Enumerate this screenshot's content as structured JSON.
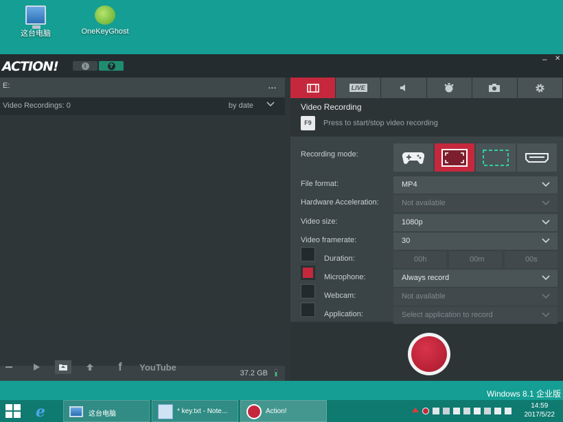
{
  "desktop": {
    "icons": [
      {
        "label": "这台电脑",
        "icon": "computer-icon"
      },
      {
        "label": "OneKeyGhost",
        "icon": "onekeyghost-icon"
      }
    ],
    "edition": "Windows 8.1 企业版"
  },
  "app": {
    "logo": "ACTION!",
    "info_glyph": "i",
    "help_glyph": "?",
    "min": "–",
    "close": "✕",
    "path": "E:",
    "path_menu": "...",
    "recordings_label": "Video Recordings: 0",
    "sort": "by date",
    "disk_free": "37.2 GB",
    "live_label": "LIVE",
    "hotkey": "F9",
    "section_title": "Video Recording",
    "hotkey_hint": "Press to start/stop video recording",
    "settings": {
      "recording_mode": "Recording mode:",
      "file_format": {
        "label": "File format:",
        "value": "MP4"
      },
      "hw_accel": {
        "label": "Hardware Acceleration:",
        "value": "Not available"
      },
      "video_size": {
        "label": "Video size:",
        "value": "1080p"
      },
      "framerate": {
        "label": "Video framerate:",
        "value": "30"
      },
      "duration": {
        "label": "Duration:",
        "h": "00h",
        "m": "00m",
        "s": "00s"
      },
      "microphone": {
        "label": "Microphone:",
        "value": "Always record"
      },
      "webcam": {
        "label": "Webcam:",
        "value": "Not available"
      },
      "application": {
        "label": "Application:",
        "value": "Select application to record"
      }
    },
    "toolbar": {
      "youtube": "YouTube"
    }
  },
  "taskbar": {
    "tasks": [
      {
        "label": "这台电脑"
      },
      {
        "label": "* key.txt - Note..."
      },
      {
        "label": "Action!"
      }
    ],
    "time": "14:59",
    "date": "2017/5/22"
  },
  "colors": {
    "accent": "#c5283d",
    "desktop": "#159e93",
    "panel": "#2e3639"
  }
}
